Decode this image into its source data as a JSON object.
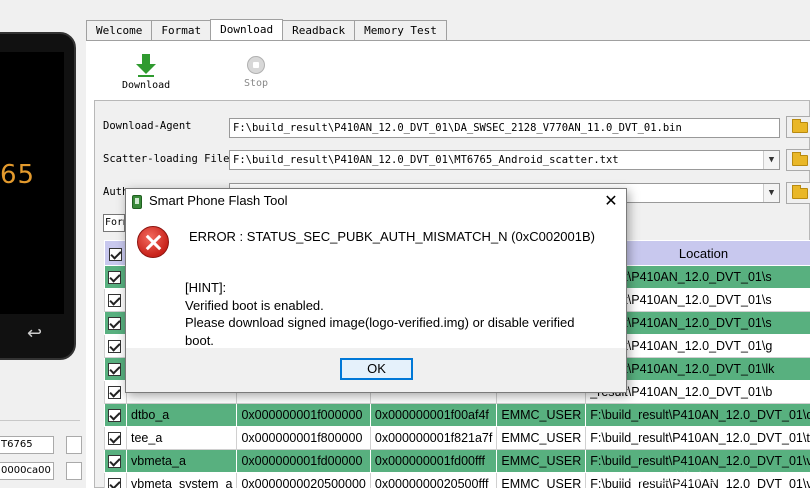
{
  "left_panel": {
    "chip_label": "65",
    "field_1": "T6765",
    "field_2": "0000ca00"
  },
  "tabs": [
    {
      "label": "Welcome",
      "active": false
    },
    {
      "label": "Format",
      "active": false
    },
    {
      "label": "Download",
      "active": true
    },
    {
      "label": "Readback",
      "active": false
    },
    {
      "label": "Memory Test",
      "active": false
    }
  ],
  "toolbar": {
    "download_label": "Download",
    "stop_label": "Stop"
  },
  "config": {
    "download_agent_label": "Download-Agent",
    "download_agent_value": "F:\\build_result\\P410AN_12.0_DVT_01\\DA_SWSEC_2128_V770AN_11.0_DVT_01.bin",
    "scatter_label": "Scatter-loading File",
    "scatter_value": "F:\\build_result\\P410AN_12.0_DVT_01\\MT6765_Android_scatter.txt",
    "auth_label": "Auth",
    "auth_value": "",
    "format_all_label": "Form"
  },
  "table": {
    "location_header": "Location",
    "rows": [
      {
        "name": "",
        "begin": "",
        "end": "",
        "region": "",
        "location": "_result\\P410AN_12.0_DVT_01\\s",
        "green": true
      },
      {
        "name": "",
        "begin": "",
        "end": "",
        "region": "",
        "location": "_result\\P410AN_12.0_DVT_01\\s",
        "green": false
      },
      {
        "name": "",
        "begin": "",
        "end": "",
        "region": "",
        "location": "_result\\P410AN_12.0_DVT_01\\s",
        "green": true
      },
      {
        "name": "",
        "begin": "",
        "end": "",
        "region": "",
        "location": "_result\\P410AN_12.0_DVT_01\\g",
        "green": false
      },
      {
        "name": "",
        "begin": "",
        "end": "",
        "region": "",
        "location": "_result\\P410AN_12.0_DVT_01\\lk",
        "green": true
      },
      {
        "name": "",
        "begin": "",
        "end": "",
        "region": "",
        "location": "_result\\P410AN_12.0_DVT_01\\b",
        "green": false
      },
      {
        "name": "dtbo_a",
        "begin": "0x000000001f000000",
        "end": "0x000000001f00af4f",
        "region": "EMMC_USER",
        "location": "F:\\build_result\\P410AN_12.0_DVT_01\\d",
        "green": true
      },
      {
        "name": "tee_a",
        "begin": "0x000000001f800000",
        "end": "0x000000001f821a7f",
        "region": "EMMC_USER",
        "location": "F:\\build_result\\P410AN_12.0_DVT_01\\te",
        "green": false
      },
      {
        "name": "vbmeta_a",
        "begin": "0x000000001fd00000",
        "end": "0x000000001fd00fff",
        "region": "EMMC_USER",
        "location": "F:\\build_result\\P410AN_12.0_DVT_01\\v",
        "green": true
      },
      {
        "name": "vbmeta_system_a",
        "begin": "0x0000000020500000",
        "end": "0x0000000020500fff",
        "region": "EMMC_USER",
        "location": "F:\\build_result\\P410AN_12.0_DVT_01\\v",
        "green": false
      }
    ]
  },
  "dialog": {
    "title": "Smart Phone Flash Tool",
    "close_glyph": "✕",
    "error": "ERROR : STATUS_SEC_PUBK_AUTH_MISMATCH_N (0xC002001B)",
    "hint_title": "[HINT]:",
    "hint_line1": "Verified boot is enabled.",
    "hint_line2": "Please download signed image(logo-verified.img) or disable verified boot.",
    "ok_label": "OK"
  },
  "watermark": "CSDN @路街青春FX",
  "colors": {
    "row_green": "#58b07f",
    "header": "#c8c8ee",
    "ok_border": "#0078d7"
  }
}
